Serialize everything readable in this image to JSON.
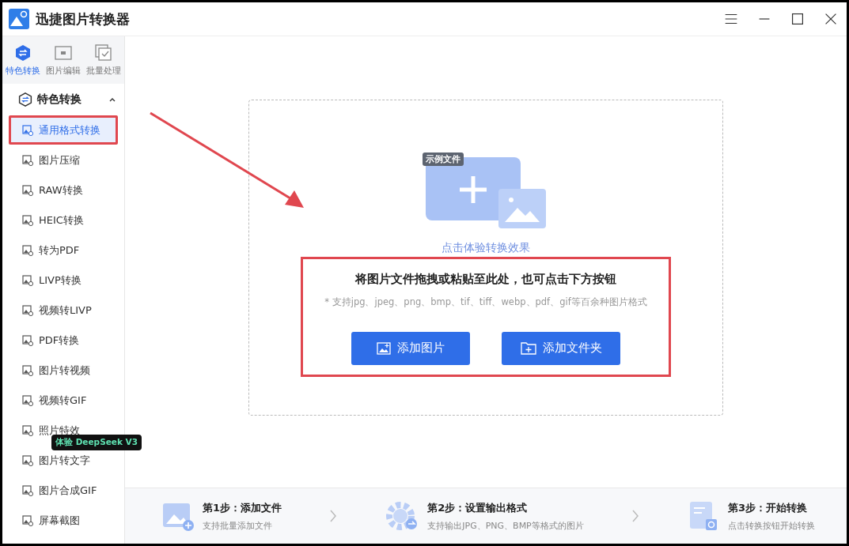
{
  "window": {
    "title": "迅捷图片转换器"
  },
  "mode_tabs": [
    {
      "label": "特色转换",
      "selected": true,
      "kind": "convert"
    },
    {
      "label": "图片编辑",
      "selected": false,
      "kind": "edit"
    },
    {
      "label": "批量处理",
      "selected": false,
      "kind": "batch"
    }
  ],
  "sidebar": {
    "section": {
      "label": "特色转换",
      "expanded": true
    },
    "items": [
      {
        "label": "通用格式转换",
        "selected": true,
        "annotated": true
      },
      {
        "label": "图片压缩",
        "selected": false,
        "annotated": false
      },
      {
        "label": "RAW转换",
        "selected": false,
        "annotated": false
      },
      {
        "label": "HEIC转换",
        "selected": false,
        "annotated": false
      },
      {
        "label": "转为PDF",
        "selected": false,
        "annotated": false
      },
      {
        "label": "LIVP转换",
        "selected": false,
        "annotated": false
      },
      {
        "label": "视频转LIVP",
        "selected": false,
        "annotated": false
      },
      {
        "label": "PDF转换",
        "selected": false,
        "annotated": false
      },
      {
        "label": "图片转视频",
        "selected": false,
        "annotated": false
      },
      {
        "label": "视频转GIF",
        "selected": false,
        "annotated": false
      },
      {
        "label": "照片特效",
        "selected": false,
        "annotated": false
      },
      {
        "label": "图片转文字",
        "selected": false,
        "annotated": false,
        "badge": "体验 DeepSeek V3"
      },
      {
        "label": "图片合成GIF",
        "selected": false,
        "annotated": false
      },
      {
        "label": "屏幕截图",
        "selected": false,
        "annotated": false
      }
    ]
  },
  "drop_area": {
    "sample_tag": "示例文件",
    "sample_link": "点击体验转换效果",
    "annotated": true,
    "headline": "将图片文件拖拽或粘贴至此处，也可点击下方按钮",
    "hint": "* 支持jpg、jpeg、png、bmp、tif、tiff、webp、pdf、gif等百余种图片格式",
    "buttons": [
      {
        "label": "添加图片",
        "kind": "image"
      },
      {
        "label": "添加文件夹",
        "kind": "folder"
      }
    ]
  },
  "steps": [
    {
      "title": "第1步：添加文件",
      "desc": "支持批量添加文件",
      "kind": "add"
    },
    {
      "title": "第2步：设置输出格式",
      "desc": "支持输出JPG、PNG、BMP等格式的图片",
      "kind": "settings"
    },
    {
      "title": "第3步：开始转换",
      "desc": "点击转换按钮开始转换",
      "kind": "start"
    }
  ]
}
